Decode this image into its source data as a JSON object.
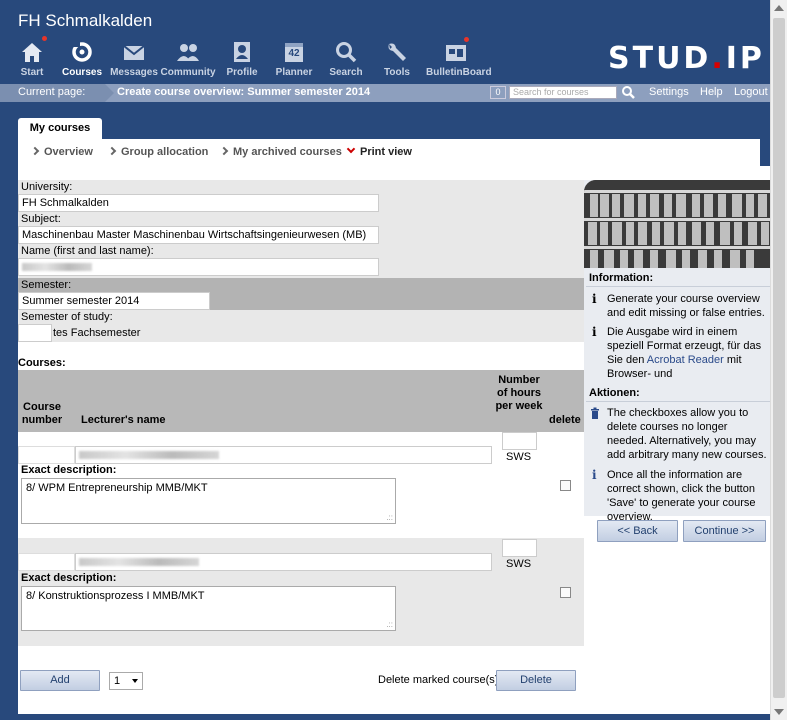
{
  "header": {
    "institution": "FH Schmalkalden",
    "nav": [
      {
        "label": "Start",
        "icon": "home-icon"
      },
      {
        "label": "Courses",
        "icon": "courses-icon"
      },
      {
        "label": "Messages",
        "icon": "mail-icon"
      },
      {
        "label": "Community",
        "icon": "community-icon"
      },
      {
        "label": "Profile",
        "icon": "profile-icon"
      },
      {
        "label": "Planner",
        "icon": "calendar-icon",
        "badge": "42"
      },
      {
        "label": "Search",
        "icon": "search-icon"
      },
      {
        "label": "Tools",
        "icon": "wrench-icon"
      },
      {
        "label": "BulletinBoard",
        "icon": "bulletinboard-icon"
      }
    ],
    "logo": {
      "part1": "STUD",
      "dot": ".",
      "part2": "IP"
    }
  },
  "breadcrumb": {
    "current_label": "Current page:",
    "title": "Create course overview: Summer semester 2014",
    "counter": "0",
    "search_placeholder": "Search for courses",
    "links": [
      "Settings",
      "Help",
      "Logout"
    ]
  },
  "tabs": {
    "active": "My courses",
    "sub": [
      "Overview",
      "Group allocation",
      "My archived courses",
      "Print view"
    ]
  },
  "form": {
    "university_label": "University:",
    "university": "FH Schmalkalden",
    "subject_label": "Subject:",
    "subject": "Maschinenbau Master Maschinenbau Wirtschaftsingenieurwesen (MB)",
    "name_label": "Name (first and last name):",
    "semester_label": "Semester:",
    "semester": "Summer semester 2014",
    "study_semester_label": "Semester of study:",
    "study_semester_suffix": "tes Fachsemester"
  },
  "courses": {
    "label": "Courses:",
    "headers": {
      "number": "Course number",
      "lecturer": "Lecturer's name",
      "hours": "Number of hours per week",
      "delete": "delete"
    },
    "sws": "SWS",
    "desc_label": "Exact description:",
    "items": [
      {
        "description": "8/ WPM Entrepreneurship MMB/MKT"
      },
      {
        "description": "8/ Konstruktionsprozess I MMB/MKT"
      }
    ]
  },
  "footer": {
    "add": "Add",
    "count": "1",
    "delete_marked": "Delete marked course(s)",
    "delete": "Delete"
  },
  "sidebar": {
    "information_title": "Information:",
    "info1": "Generate your course overview and edit missing or false entries.",
    "info2_a": "Die Ausgabe wird in einem speziell Format erzeugt, für das Sie den ",
    "info2_link": "Acrobat Reader",
    "info2_b": " mit Browser- und Formularunterstützung benötigen.",
    "actions_title": "Aktionen:",
    "action1": "The checkboxes allow you to delete courses no longer needed. Alternatively, you may add arbitrary many new courses.",
    "action2": "Once all the information are correct shown, click the button 'Save' to generate your course overview.",
    "back": "<< Back",
    "continue": "Continue >>"
  }
}
